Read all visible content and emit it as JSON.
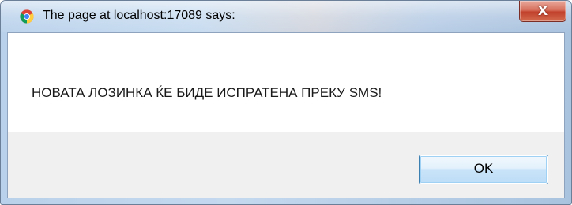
{
  "window": {
    "title": "The page at localhost:17089 says:",
    "close_label": "X",
    "app_icon": "chrome-icon"
  },
  "dialog": {
    "message": "НОВАТА ЛОЗИНКА ЌЕ БИДЕ ИСПРАТЕНА ПРЕКУ SMS!",
    "ok_label": "OK"
  },
  "colors": {
    "title_bar": "#bcd3ec",
    "close_button": "#c1412c",
    "ok_button_border": "#3c7fb1",
    "button_bar": "#f0f0f0"
  }
}
